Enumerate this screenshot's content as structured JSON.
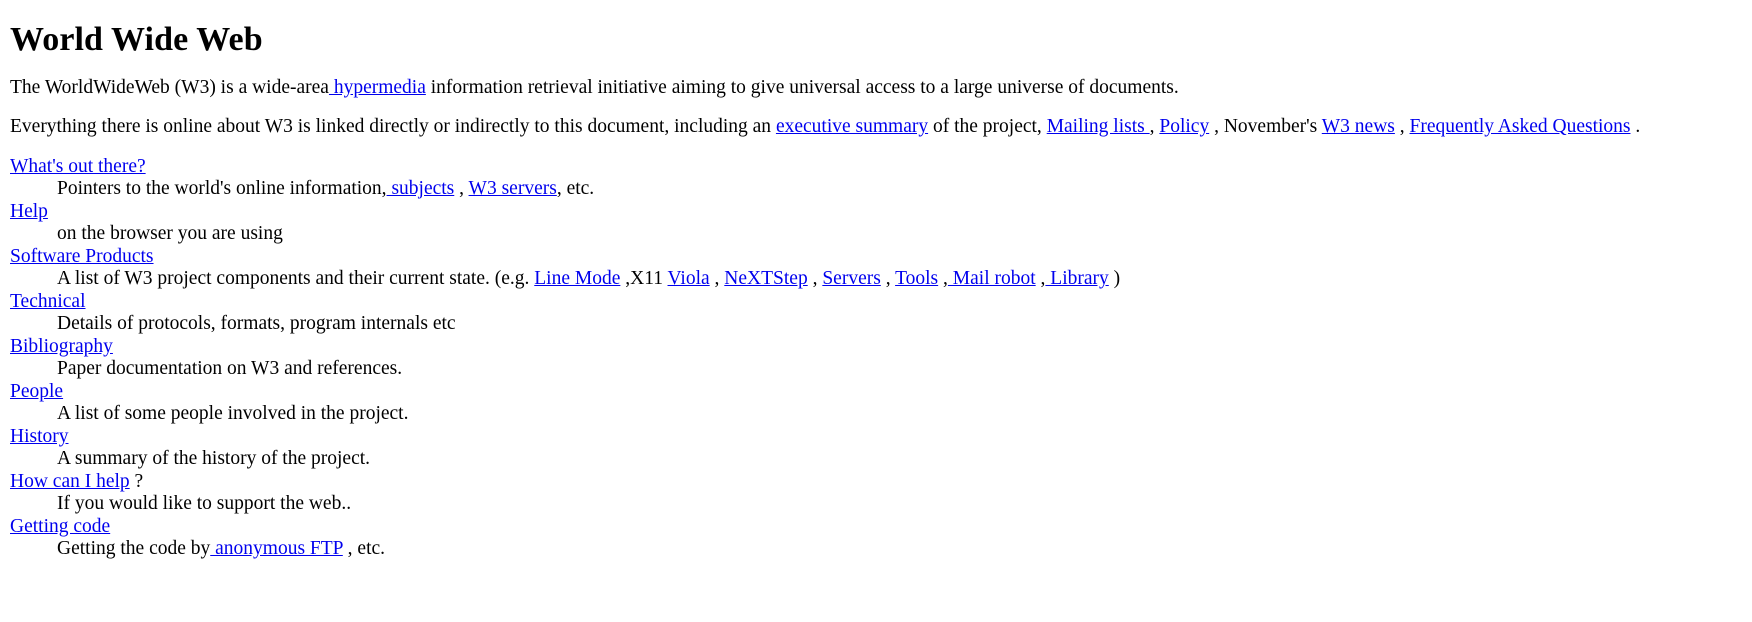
{
  "document": {
    "title": "World Wide Web",
    "link_color": "#0000EE",
    "text_color": "#000000",
    "background_color": "#FFFFFF"
  },
  "paragraphs": {
    "p1": {
      "before_link": "The WorldWideWeb (W3) is a wide-area",
      "link": " hypermedia",
      "after_link": " information retrieval initiative aiming to give universal access to a large universe of documents."
    },
    "p2": {
      "s1": "Everything there is online about W3 is linked directly or indirectly to this document, including an ",
      "link1": "executive summary",
      "s2": " of the project, ",
      "link2": "Mailing lists ",
      "s3": ", ",
      "link3": "Policy",
      "s4": " , November's ",
      "link4": "W3 news",
      "s5": " , ",
      "link5": "Frequently Asked Questions",
      "s6": " ."
    }
  },
  "index": [
    {
      "term": "What's out there?",
      "desc_parts": [
        {
          "type": "text",
          "value": "Pointers to the world's online information,"
        },
        {
          "type": "link",
          "value": " subjects"
        },
        {
          "type": "text",
          "value": " , "
        },
        {
          "type": "link",
          "value": "W3 servers"
        },
        {
          "type": "text",
          "value": ", etc."
        }
      ]
    },
    {
      "term": "Help",
      "desc_parts": [
        {
          "type": "text",
          "value": "on the browser you are using"
        }
      ]
    },
    {
      "term": "Software Products",
      "desc_parts": [
        {
          "type": "text",
          "value": "A list of W3 project components and their current state. (e.g. "
        },
        {
          "type": "link",
          "value": "Line Mode"
        },
        {
          "type": "text",
          "value": " ,X11 "
        },
        {
          "type": "link",
          "value": "Viola"
        },
        {
          "type": "text",
          "value": " , "
        },
        {
          "type": "link",
          "value": "NeXTStep"
        },
        {
          "type": "text",
          "value": " , "
        },
        {
          "type": "link",
          "value": "Servers"
        },
        {
          "type": "text",
          "value": " , "
        },
        {
          "type": "link",
          "value": "Tools"
        },
        {
          "type": "text",
          "value": " ,"
        },
        {
          "type": "link",
          "value": " Mail robot"
        },
        {
          "type": "text",
          "value": " ,"
        },
        {
          "type": "link",
          "value": " Library"
        },
        {
          "type": "text",
          "value": " )"
        }
      ]
    },
    {
      "term": "Technical",
      "desc_parts": [
        {
          "type": "text",
          "value": "Details of protocols, formats, program internals etc"
        }
      ]
    },
    {
      "term": "Bibliography",
      "desc_parts": [
        {
          "type": "text",
          "value": "Paper documentation on W3 and references."
        }
      ]
    },
    {
      "term": "People",
      "desc_parts": [
        {
          "type": "text",
          "value": "A list of some people involved in the project."
        }
      ]
    },
    {
      "term": "History",
      "desc_parts": [
        {
          "type": "text",
          "value": "A summary of the history of the project."
        }
      ]
    },
    {
      "term": "How can I help",
      "term_suffix": " ?",
      "desc_parts": [
        {
          "type": "text",
          "value": "If you would like to support the web.."
        }
      ]
    },
    {
      "term": "Getting code",
      "desc_parts": [
        {
          "type": "text",
          "value": "Getting the code by"
        },
        {
          "type": "link",
          "value": " anonymous FTP"
        },
        {
          "type": "text",
          "value": " , etc."
        }
      ]
    }
  ]
}
